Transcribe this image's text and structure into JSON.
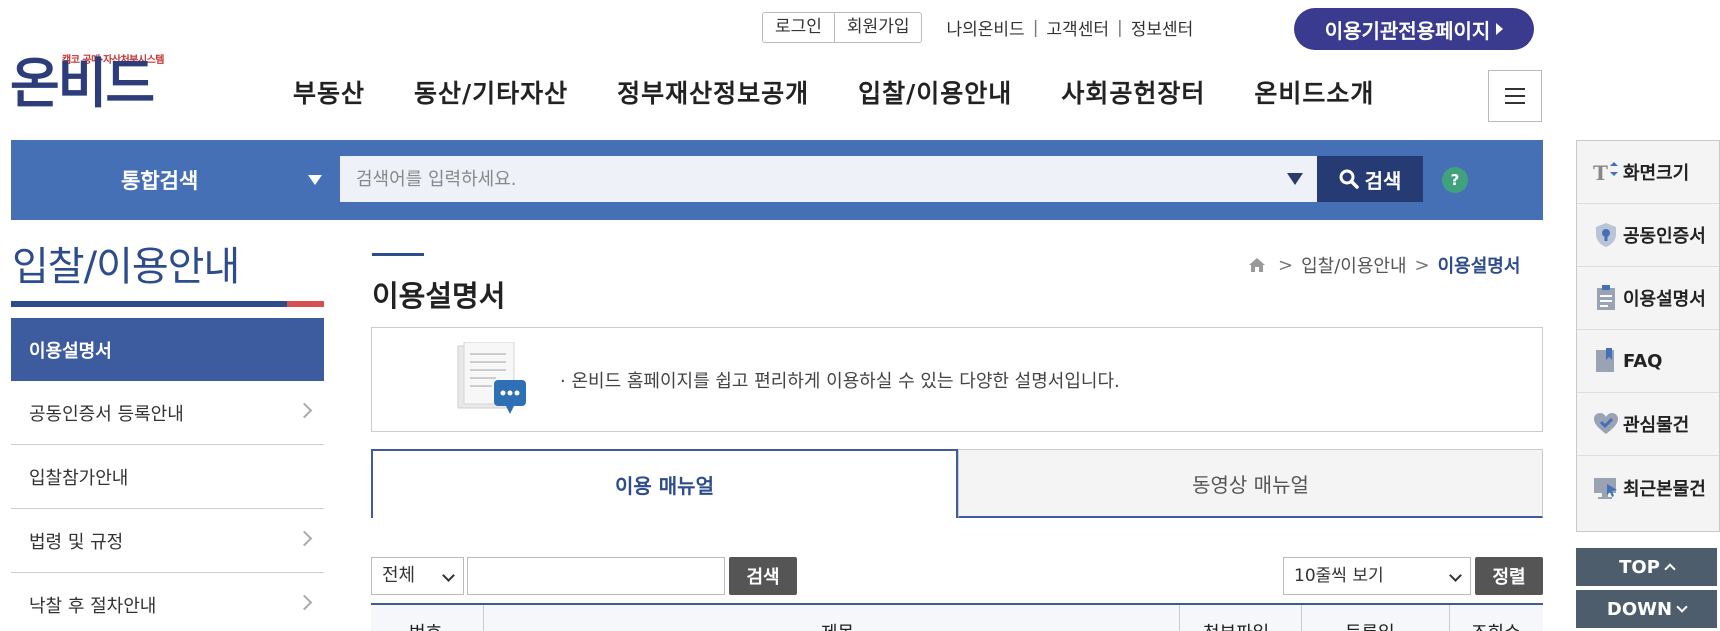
{
  "util": {
    "login": "로그인",
    "signup": "회원가입",
    "my_onbid": "나의온비드",
    "customer_center": "고객센터",
    "info_center": "정보센터",
    "separator": "|",
    "org_page": "이용기관전용페이지"
  },
  "logo": {
    "tagline": "캠코 공매·자산처분시스템",
    "wordmark": "온비드"
  },
  "gnb": [
    "부동산",
    "동산/기타자산",
    "정부재산정보공개",
    "입찰/이용안내",
    "사회공헌장터",
    "온비드소개"
  ],
  "search": {
    "category": "통합검색",
    "placeholder": "검색어를 입력하세요.",
    "button": "검색",
    "help": "?"
  },
  "lnb": {
    "title": "입찰/이용안내",
    "items": [
      {
        "label": "이용설명서"
      },
      {
        "label": "공동인증서 등록안내"
      },
      {
        "label": "입찰참가안내"
      },
      {
        "label": "법령 및 규정"
      },
      {
        "label": "낙찰 후 절차안내"
      }
    ]
  },
  "content": {
    "title": "이용설명서",
    "breadcrumb": {
      "sep": ">",
      "section": "입찰/이용안내",
      "current": "이용설명서"
    },
    "intro": "온비드 홈페이지를 쉽고 편리하게 이용하실 수 있는 다양한 설명서입니다.",
    "tabs": [
      "이용 매뉴얼",
      "동영상 매뉴얼"
    ],
    "filter": {
      "scope": "전체",
      "search_btn": "검색",
      "rows": "10줄씩 보기",
      "sort_btn": "정렬"
    },
    "table_headers": [
      "번호",
      "제목",
      "첨부파일",
      "등록일",
      "조회수"
    ]
  },
  "quick": {
    "items": [
      "화면크기",
      "공동인증서",
      "이용설명서",
      "FAQ",
      "관심물건",
      "최근본물건"
    ],
    "top": "TOP",
    "down": "DOWN"
  },
  "colors": {
    "primary": "#4570b6",
    "navy": "#2c4c8c",
    "org_button": "#3a3b8f",
    "help": "#40a27d"
  }
}
